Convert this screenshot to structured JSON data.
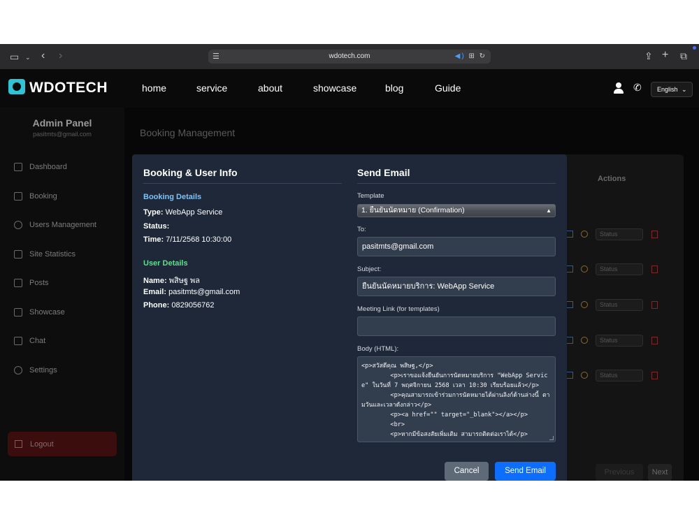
{
  "browser": {
    "url": "wdotech.com"
  },
  "header": {
    "logo": "WDOTECH",
    "nav": [
      "home",
      "service",
      "about",
      "showcase",
      "blog",
      "Guide"
    ],
    "language": "English"
  },
  "sidebar": {
    "title": "Admin Panel",
    "email": "pasitmts@gmail.com",
    "items": [
      {
        "label": "Dashboard",
        "icon": "grid-icon"
      },
      {
        "label": "Booking",
        "icon": "book-icon"
      },
      {
        "label": "Users Management",
        "icon": "users-icon"
      },
      {
        "label": "Site Statistics",
        "icon": "bar-chart-icon"
      },
      {
        "label": "Posts",
        "icon": "document-icon"
      },
      {
        "label": "Showcase",
        "icon": "image-icon"
      },
      {
        "label": "Chat",
        "icon": "chat-icon"
      },
      {
        "label": "Settings",
        "icon": "gear-icon"
      }
    ],
    "logout": "Logout"
  },
  "main": {
    "title": "Booking Management",
    "actions_header": "Actions",
    "status_placeholder": "Status",
    "pagination": {
      "previous": "Previous",
      "next": "Next"
    }
  },
  "modal": {
    "left_title": "Booking & User Info",
    "booking_heading": "Booking Details",
    "type_label": "Type:",
    "type_value": "WebApp Service",
    "status_label": "Status:",
    "time_label": "Time:",
    "time_value": "7/11/2568 10:30:00",
    "user_heading": "User Details",
    "name_label": "Name:",
    "name_value": "พสิษฐ พล",
    "email_label": "Email:",
    "email_value": "pasitmts@gmail.com",
    "phone_label": "Phone:",
    "phone_value": "0829056762",
    "right_title": "Send Email",
    "template_label": "Template",
    "template_value": "1. ยืนยันนัดหมาย (Confirmation)",
    "to_label": "To:",
    "to_value": "pasitmts@gmail.com",
    "subject_label": "Subject:",
    "subject_value": "ยืนยันนัดหมายบริการ: WebApp Service",
    "meeting_label": "Meeting Link (for templates)",
    "meeting_value": "",
    "body_label": "Body (HTML):",
    "body_value": "<p>สวัสดีคุณ พสิษฐ,</p>\n        <p>เราขอแจ้งยืนยันการนัดหมายบริการ \"WebApp Service\" ในวันที่ 7 พฤศจิกายน 2568 เวลา 10:30 เรียบร้อยแล้ว</p>\n        <p>คุณสามารถเข้าร่วมการนัดหมายได้ผ่านลิงก์ด้านล่างนี้ ตามวันและเวลาดังกล่าว</p>\n        <p><a href=\"\" target=\"_blank\"></a></p>\n        <br>\n        <p>หากมีข้อสงสัยเพิ่มเติม สามารถติดต่อเราได้</p>",
    "cancel": "Cancel",
    "send": "Send Email"
  },
  "colors": {
    "modal_bg": "#1e2838",
    "booking_heading": "#7cc4f8",
    "user_heading": "#5ce08a",
    "primary": "#0d6efd",
    "secondary": "#5f6a79",
    "logout_bg": "#3b0d0d"
  }
}
